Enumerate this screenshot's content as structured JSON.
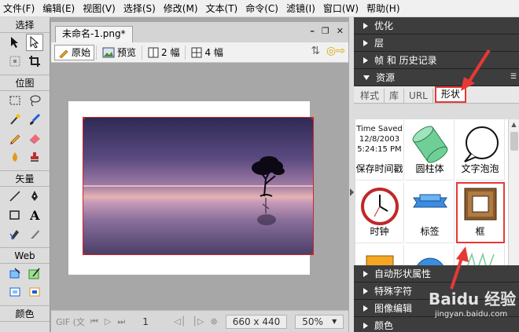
{
  "menu": [
    "文件(F)",
    "编辑(E)",
    "视图(V)",
    "选择(S)",
    "修改(M)",
    "文本(T)",
    "命令(C)",
    "滤镜(I)",
    "窗口(W)",
    "帮助(H)"
  ],
  "tools": {
    "select_title": "选择",
    "bitmap_title": "位图",
    "vector_title": "矢量",
    "web_title": "Web",
    "colors_title": "颜色",
    "text_tool_glyph": "A"
  },
  "document": {
    "tab_title": "未命名-1.png*",
    "views": {
      "original": "原始",
      "preview": "预览",
      "two_up": "2 幅",
      "four_up": "4 幅"
    },
    "status": {
      "format": "GIF (文",
      "page": "1",
      "size": "660 x 440",
      "zoom": "50%"
    }
  },
  "panels": {
    "optimize": "优化",
    "layers": "层",
    "frames_history": "帧 和 历史记录",
    "assets": "资源",
    "auto_shape_props": "自动形状属性",
    "special_chars": "特殊字符",
    "image_edit": "图像编辑",
    "colors": "颜色"
  },
  "asset_tabs": [
    "样式",
    "库",
    "URL",
    "形状"
  ],
  "shapes": [
    {
      "label": "保存时间戳",
      "icon": "timestamp-icon",
      "ts_line1": "Time Saved",
      "ts_line2": "12/8/2003",
      "ts_line3": "5:24:15 PM"
    },
    {
      "label": "圆柱体",
      "icon": "cylinder-icon"
    },
    {
      "label": "文字泡泡",
      "icon": "speech-bubble-icon"
    },
    {
      "label": "时钟",
      "icon": "clock-icon"
    },
    {
      "label": "标签",
      "icon": "tag-icon"
    },
    {
      "label": "框",
      "icon": "frame-icon"
    }
  ],
  "watermark": {
    "line1": "Baidu 经验",
    "line2": "jingyan.baidu.com"
  },
  "colors": {
    "accent_red": "#e53935",
    "panel_header": "#3d3d3d",
    "selection_red": "#c62828"
  }
}
